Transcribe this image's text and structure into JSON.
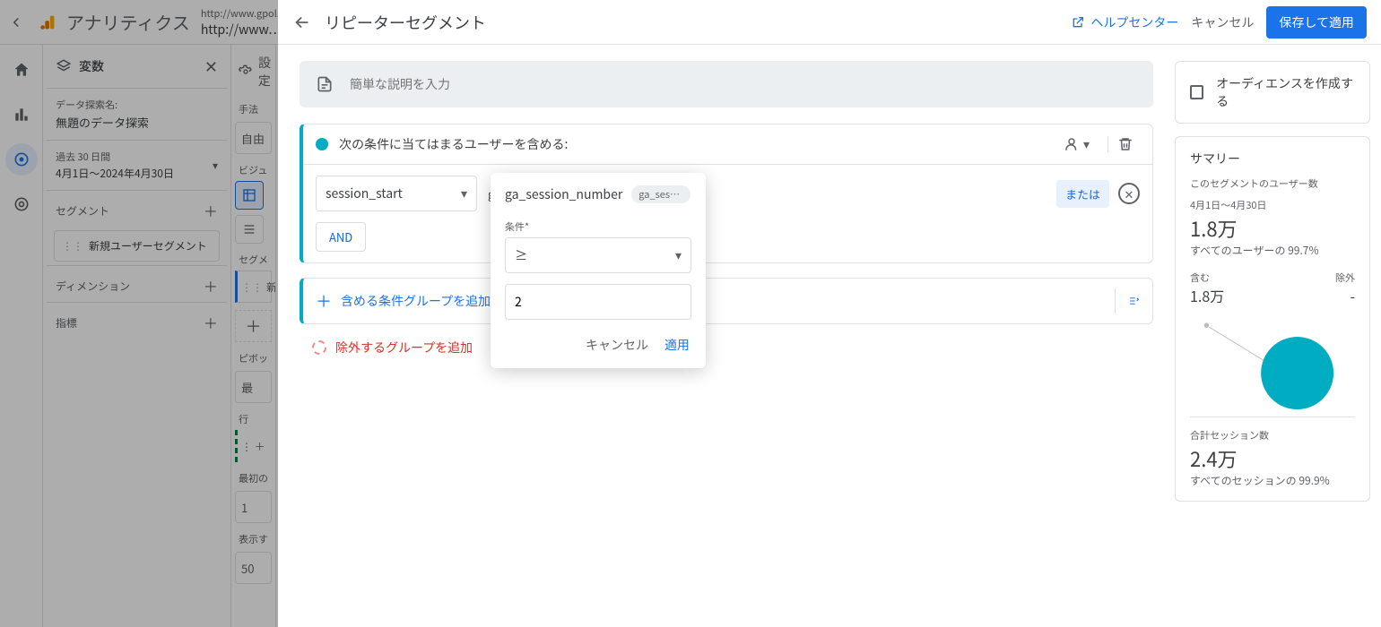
{
  "app": {
    "name": "アナリティクス",
    "property_url": "http://www.gpol.co.jp",
    "property_display": "http://www…"
  },
  "variables": {
    "title": "変数",
    "exploration_label": "データ探索名:",
    "exploration_value": "無題のデータ探索",
    "date_label": "過去 30 日間",
    "date_value": "4月1日～2024年4月30日",
    "segments_label": "セグメント",
    "segment_chip": "新規ユーザーセグメント",
    "dimensions_label": "ディメンション",
    "metrics_label": "指標"
  },
  "settings": {
    "title": "設定",
    "technique_label": "手法",
    "technique_value": "自由",
    "viz_label": "ビジュ",
    "seg_label": "セグメ",
    "seg_chip": "新",
    "pivot_label": "ピボッ",
    "pivot_value": "最",
    "rows_label": "行",
    "first_row_label": "最初の",
    "first_row_value": "1",
    "show_rows_label": "表示す",
    "show_rows_value": "50"
  },
  "panel": {
    "title": "リピーターセグメント",
    "help_label": "ヘルプセンター",
    "cancel_label": "キャンセル",
    "save_label": "保存して適用",
    "description_placeholder": "簡単な説明を入力",
    "include_title": "次の条件に当てはまるユーザーを含める:",
    "event_value": "session_start",
    "param_name": "ga_session_number",
    "param_chip": "ga_sessi…",
    "or_label": "または",
    "and_label": "AND",
    "add_group_label": "含める条件グループを追加",
    "exclude_label": "除外するグループを追加",
    "audience_label": "オーディエンスを作成する",
    "summary_title": "サマリー",
    "users_count_label": "このセグメントのユーザー数",
    "users_date_range": "4月1日～4月30日",
    "users_count": "1.8万",
    "users_pct": "すべてのユーザーの 99.7%",
    "include_label_small": "含む",
    "exclude_label_small": "除外",
    "include_value": "1.8万",
    "exclude_value": "-",
    "sessions_label": "合計セッション数",
    "sessions_value": "2.4万",
    "sessions_pct": "すべてのセッションの 99.9%"
  },
  "popover": {
    "param_name": "ga_session_number",
    "param_chip": "ga_sessi…",
    "condition_label": "条件*",
    "operator_value": "≥",
    "value": "2",
    "cancel_label": "キャンセル",
    "apply_label": "適用"
  },
  "chart_data": {
    "type": "pie",
    "title": "",
    "series": [
      {
        "name": "含む",
        "value": 18000,
        "color": "#00acc1"
      },
      {
        "name": "除外",
        "value": 0,
        "color": "#bdbdbd"
      }
    ],
    "subtitle": "すべてのユーザーの 99.7%"
  }
}
